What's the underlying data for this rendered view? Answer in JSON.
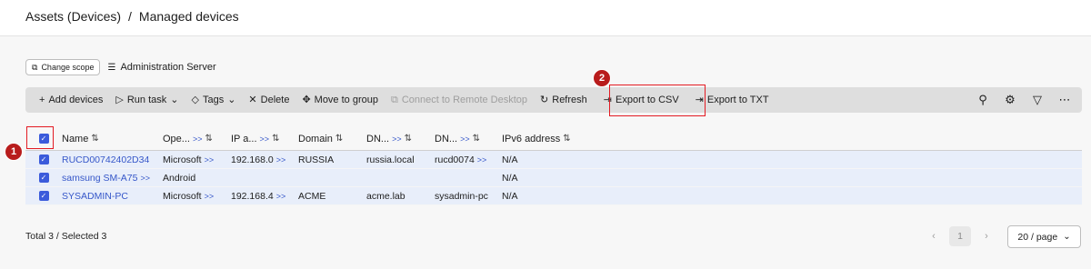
{
  "breadcrumb": {
    "parent": "Assets (Devices)",
    "separator": "/",
    "current": "Managed devices"
  },
  "scope": {
    "change_scope_label": "Change scope",
    "server_label": "Administration Server"
  },
  "toolbar": {
    "add_devices": "Add devices",
    "run_task": "Run task",
    "tags": "Tags",
    "delete": "Delete",
    "move_to_group": "Move to group",
    "connect_remote": "Connect to Remote Desktop",
    "refresh": "Refresh",
    "export_csv": "Export to CSV",
    "export_txt": "Export to TXT"
  },
  "annotations": {
    "marker_1": "1",
    "marker_2": "2",
    "highlight_color": "#e31b23"
  },
  "table": {
    "columns": [
      "Name",
      "Ope...",
      "IP a...",
      "Domain",
      "DN...",
      "DN...",
      "IPv6 address"
    ],
    "expand_label": ">>",
    "rows": [
      {
        "name": "RUCD00742402D34",
        "os": "Microsoft",
        "ip": "192.168.0",
        "domain": "RUSSIA",
        "dns_domain": "russia.local",
        "dns_name": "rucd0074",
        "ipv6": "N/A"
      },
      {
        "name": "samsung SM-A75",
        "os": "Android",
        "ip": "",
        "domain": "",
        "dns_domain": "",
        "dns_name": "",
        "ipv6": "N/A"
      },
      {
        "name": "SYSADMIN-PC",
        "os": "Microsoft",
        "ip": "192.168.4",
        "domain": "ACME",
        "dns_domain": "acme.lab",
        "dns_name": "sysadmin-pc",
        "ipv6": "N/A"
      }
    ]
  },
  "footer": {
    "total_text": "Total 3 / Selected 3"
  },
  "pagination": {
    "current_page": "1",
    "page_size": "20 / page"
  },
  "colors": {
    "accent": "#3b5bdb",
    "link": "#3657c9",
    "row_selected": "#e8eefa",
    "toolbar_bg": "#dedede"
  }
}
